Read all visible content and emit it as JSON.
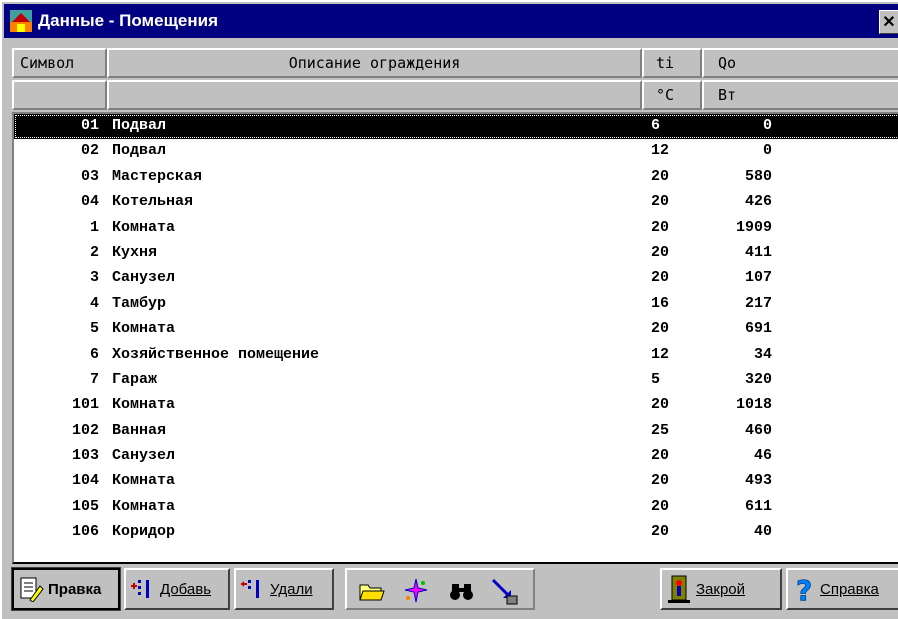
{
  "window": {
    "title": "Данные - Помещения",
    "close_label": "✕"
  },
  "header": {
    "row1": {
      "sym": "Символ",
      "desc": "Описание ограждения",
      "ti": "ti",
      "qo": "Qo"
    },
    "row2": {
      "sym": "",
      "desc": "",
      "ti": "°C",
      "qo": "Вт"
    }
  },
  "rows": [
    {
      "num": "01",
      "name": "Подвал",
      "ti": "6",
      "qo": "0"
    },
    {
      "num": "02",
      "name": "Подвал",
      "ti": "12",
      "qo": "0"
    },
    {
      "num": "03",
      "name": "Мастерская",
      "ti": "20",
      "qo": "580"
    },
    {
      "num": "04",
      "name": "Котельная",
      "ti": "20",
      "qo": "426"
    },
    {
      "num": "1",
      "name": "Комната",
      "ti": "20",
      "qo": "1909"
    },
    {
      "num": "2",
      "name": "Кухня",
      "ti": "20",
      "qo": "411"
    },
    {
      "num": "3",
      "name": "Санузел",
      "ti": "20",
      "qo": "107"
    },
    {
      "num": "4",
      "name": "Тамбур",
      "ti": "16",
      "qo": "217"
    },
    {
      "num": "5",
      "name": "Комната",
      "ti": "20",
      "qo": "691"
    },
    {
      "num": "6",
      "name": "Хозяйственное помещение",
      "ti": "12",
      "qo": "34"
    },
    {
      "num": "7",
      "name": "Гараж",
      "ti": "5",
      "qo": "320"
    },
    {
      "num": "101",
      "name": "Комната",
      "ti": "20",
      "qo": "1018"
    },
    {
      "num": "102",
      "name": "Ванная",
      "ti": "25",
      "qo": "460"
    },
    {
      "num": "103",
      "name": "Санузел",
      "ti": "20",
      "qo": "46"
    },
    {
      "num": "104",
      "name": "Комната",
      "ti": "20",
      "qo": "493"
    },
    {
      "num": "105",
      "name": "Комната",
      "ti": "20",
      "qo": "611"
    },
    {
      "num": "106",
      "name": "Коридор",
      "ti": "20",
      "qo": "40"
    }
  ],
  "selected_row": 0,
  "toolbar": {
    "edit_label": "Правка",
    "add_label": "Добавь",
    "delete_label": "Удали",
    "close_label": "Закрой",
    "help_label": "Справка"
  },
  "colors": {
    "titlebar": "#000080",
    "face": "#c0c0c0",
    "selection": "#000000"
  }
}
